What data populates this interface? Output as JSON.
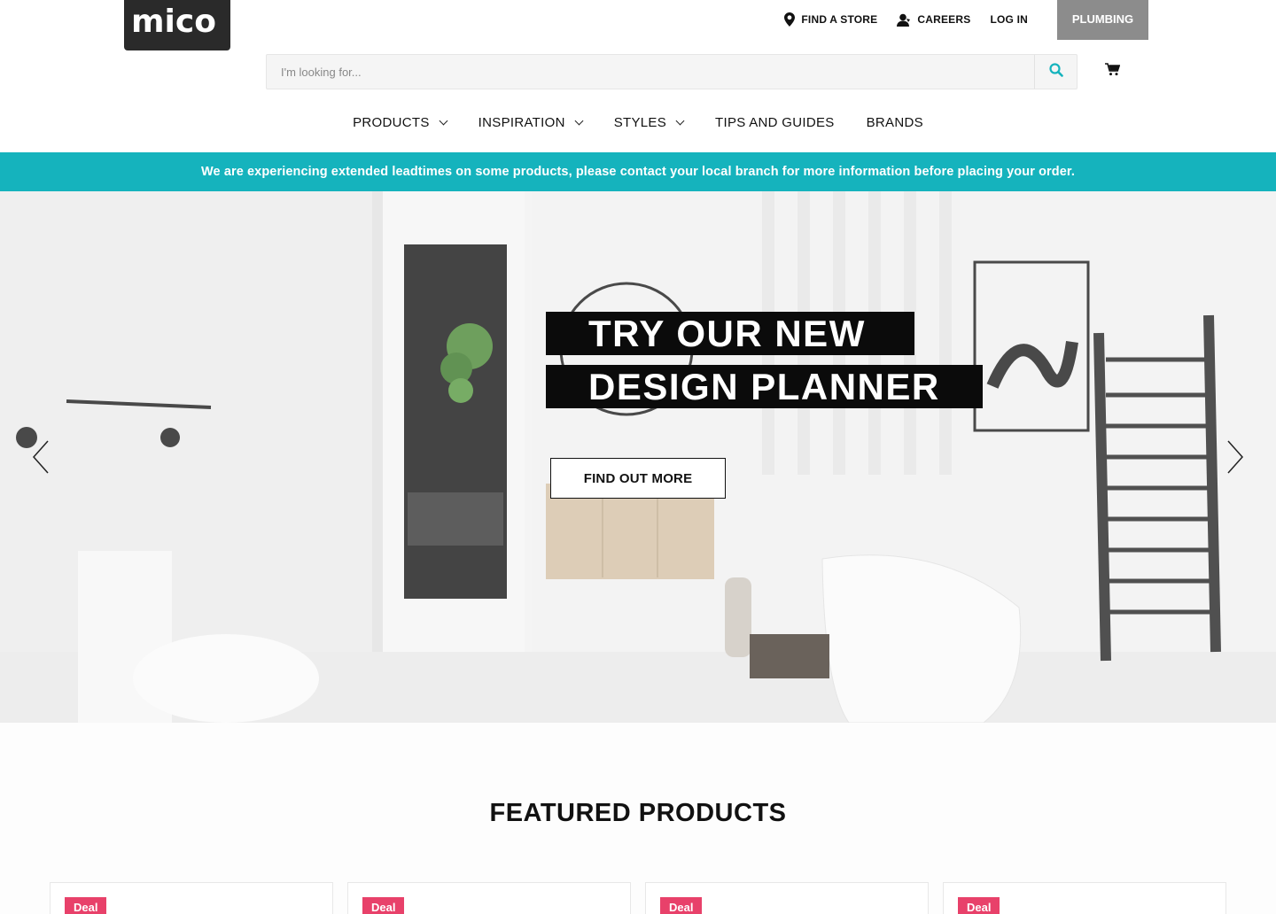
{
  "brand": {
    "logo_text": "mico"
  },
  "toplinks": [
    {
      "label": "FIND A STORE",
      "icon": "location-pin-icon"
    },
    {
      "label": "CAREERS",
      "icon": "person-icon"
    },
    {
      "label": "LOG IN"
    }
  ],
  "division_button": "PLUMBING",
  "search": {
    "placeholder": "I'm looking for...",
    "value": "",
    "icon": "search-icon"
  },
  "cart_icon": "cart-icon",
  "nav": [
    {
      "label": "PRODUCTS",
      "has_dropdown": true
    },
    {
      "label": "INSPIRATION",
      "has_dropdown": true
    },
    {
      "label": "STYLES",
      "has_dropdown": true
    },
    {
      "label": "TIPS AND GUIDES",
      "has_dropdown": false
    },
    {
      "label": "BRANDS",
      "has_dropdown": false
    }
  ],
  "notice": "We are experiencing extended leadtimes on some products, please contact your local branch for more information before placing your order.",
  "hero": {
    "headline_line1": "TRY OUR NEW",
    "headline_line2": "DESIGN PLANNER",
    "cta": "FIND OUT MORE",
    "prev_icon": "chevron-left-icon",
    "next_icon": "chevron-right-icon"
  },
  "featured": {
    "title": "FEATURED PRODUCTS",
    "cards": [
      {
        "badge": "Deal"
      },
      {
        "badge": "Deal"
      },
      {
        "badge": "Deal"
      },
      {
        "badge": "Deal"
      }
    ]
  },
  "colors": {
    "accent": "#15b3bd",
    "deal": "#e8416a",
    "division": "#8c8c8c"
  }
}
